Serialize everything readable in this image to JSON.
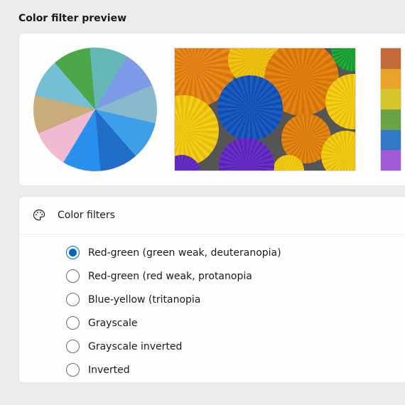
{
  "preview": {
    "title": "Color filter preview"
  },
  "strip_colors": [
    "#c26a3a",
    "#e8a42a",
    "#d4c62b",
    "#6aa246",
    "#2f79c7",
    "#a15bd8"
  ],
  "panel": {
    "title": "Color filters"
  },
  "filters": [
    {
      "label": "Red-green (green weak, deuteranopia)",
      "selected": true
    },
    {
      "label": "Red-green (red weak, protanopia",
      "selected": false
    },
    {
      "label": "Blue-yellow (tritanopia",
      "selected": false
    },
    {
      "label": "Grayscale",
      "selected": false
    },
    {
      "label": "Grayscale inverted",
      "selected": false
    },
    {
      "label": "Inverted",
      "selected": false
    }
  ]
}
